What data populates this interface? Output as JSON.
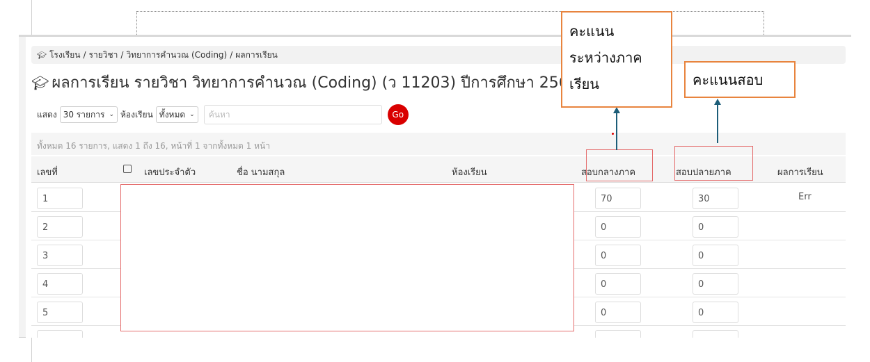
{
  "breadcrumb": {
    "school": "โรงเรียน",
    "sep": "/",
    "subject": "รายวิชา",
    "course": "วิทยาการคำนวณ (Coding)",
    "page": "ผลการเรียน"
  },
  "title": "ผลการเรียน รายวิชา วิทยาการคำนวณ (Coding) (ว 11203) ปีการศึกษา 2566/3",
  "filters": {
    "show_label": "แสดง",
    "page_size": "30 รายการ",
    "class_label": "ห้องเรียน",
    "class_value": "ทั้งหมด",
    "search_placeholder": "ค้นหา",
    "go_label": "Go"
  },
  "summary": "ทั้งหมด 16 รายการ, แสดง 1 ถึง 16, หน้าที่ 1 จากทั้งหมด 1 หน้า",
  "columns": {
    "number": "เลขที่",
    "student_id": "เลขประจำตัว",
    "name": "ชื่อ นามสกุล",
    "classroom": "ห้องเรียน",
    "midterm": "สอบกลางภาค",
    "final": "สอบปลายภาค",
    "result": "ผลการเรียน"
  },
  "rows": [
    {
      "number": "1",
      "midterm": "70",
      "final": "30",
      "result": "Err"
    },
    {
      "number": "2",
      "midterm": "0",
      "final": "0",
      "result": ""
    },
    {
      "number": "3",
      "midterm": "0",
      "final": "0",
      "result": ""
    },
    {
      "number": "4",
      "midterm": "0",
      "final": "0",
      "result": ""
    },
    {
      "number": "5",
      "midterm": "0",
      "final": "0",
      "result": ""
    }
  ],
  "annotations": {
    "midterm_callout_line1": "คะแนน",
    "midterm_callout_line2": "ระหว่างภาค",
    "midterm_callout_line3": "เรียน",
    "final_callout": "คะแนนสอบ"
  },
  "colors": {
    "go_button": "#d90000",
    "highlight_border": "#e46c6c",
    "callout_border": "#e8843e",
    "arrow": "#1c5d78"
  }
}
